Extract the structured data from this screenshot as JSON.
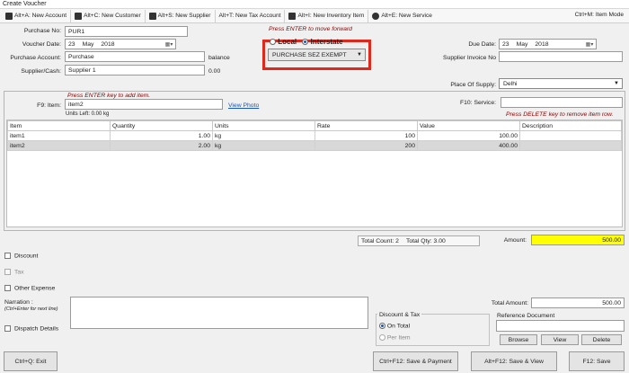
{
  "window": {
    "title": "Create Voucher"
  },
  "toolbar": {
    "items": [
      {
        "label": "Alt+A: New Account",
        "icon": "dollar-icon"
      },
      {
        "label": "Alt+C: New Customer",
        "icon": "customer-icon"
      },
      {
        "label": "Alt+S: New Supplier",
        "icon": "supplier-icon"
      },
      {
        "label": "Alt+T: New Tax Account",
        "icon": "tax-icon"
      },
      {
        "label": "Alt+I: New Inventory Item",
        "icon": "inventory-icon"
      },
      {
        "label": "Alt+E: New Service",
        "icon": "service-icon"
      }
    ],
    "item_mode": "Ctrl+M: Item Mode"
  },
  "header": {
    "purchase_no_label": "Purchase No:",
    "purchase_no_value": "PUR1",
    "voucher_date_label": "Voucher Date:",
    "voucher_date": {
      "day": "23",
      "month": "May",
      "year": "2018"
    },
    "purchase_account_label": "Purchase Account:",
    "purchase_account_value": "Purchase",
    "balance_label": "balance",
    "supplier_label": "Supplier/Cash:",
    "supplier_value": "Supplier 1",
    "supplier_balance": "0.00",
    "enter_hint": "Press ENTER to move forward",
    "local_label": "Local",
    "interstate_label": "Interstate",
    "purchase_type": "PURCHASE SEZ EXEMPT",
    "due_date_label": "Due Date:",
    "due_date": {
      "day": "23",
      "month": "May",
      "year": "2018"
    },
    "supplier_invoice_label": "Supplier Invoice No",
    "supplier_invoice_value": "",
    "place_of_supply_label": "Place Of Supply:",
    "place_of_supply_value": "Delhi"
  },
  "item_entry": {
    "add_hint": "Press ENTER key to add item.",
    "item_label": "F9: Item:",
    "item_value": "item2",
    "view_photo": "View Photo",
    "units_left": "Units Left: 0.00 kg",
    "service_label": "F10: Service:",
    "service_value": "",
    "delete_hint": "Press DELETE key to remove item row."
  },
  "grid": {
    "columns": [
      "Item",
      "Quantity",
      "Units",
      "Rate",
      "Value",
      "Description"
    ],
    "rows": [
      {
        "item": "item1",
        "quantity": "1.00",
        "units": "kg",
        "rate": "100",
        "value": "100.00",
        "description": ""
      },
      {
        "item": "item2",
        "quantity": "2.00",
        "units": "kg",
        "rate": "200",
        "value": "400.00",
        "description": ""
      }
    ]
  },
  "totals": {
    "total_count": "Total Count: 2",
    "total_qty": "Total Qty: 3.00",
    "amount_label": "Amount:",
    "amount_value": "500.00",
    "total_amount_label": "Total Amount:",
    "total_amount_value": "500.00"
  },
  "options": {
    "discount": "Discount",
    "tax": "Tax",
    "other_expense": "Other Expense",
    "narration_label": "Narration :",
    "narration_hint": "(Ctrl+Enter for next line)",
    "narration_value": "",
    "dispatch_details": "Dispatch Details"
  },
  "discount_tax": {
    "title": "Discount & Tax",
    "on_total": "On Total",
    "per_item": "Per Item"
  },
  "reference": {
    "title": "Reference Document",
    "value": "",
    "browse": "Browse",
    "view": "View",
    "delete": "Delete"
  },
  "footer": {
    "exit": "Ctrl+Q: Exit",
    "save_payment": "Ctrl+F12: Save & Payment",
    "save_view": "Alt+F12: Save & View",
    "save": "F12: Save"
  },
  "colors": {
    "highlight": "#ffff00",
    "hint": "#8b0000",
    "callout": "#e0281c"
  }
}
